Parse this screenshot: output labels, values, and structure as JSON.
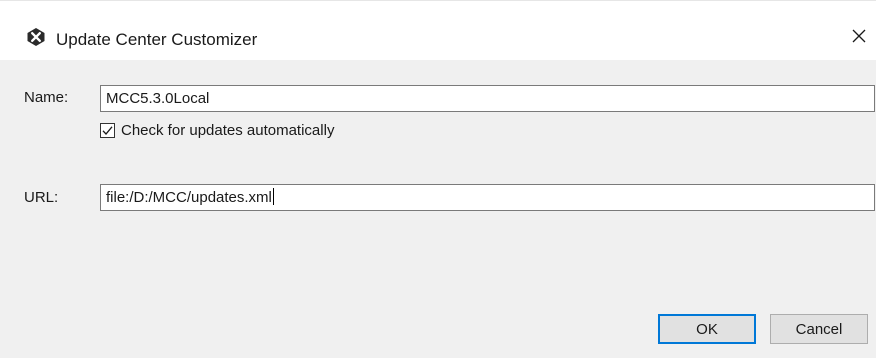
{
  "window": {
    "title": "Update Center Customizer",
    "app_icon": "x-app-icon",
    "close_icon": "close-icon"
  },
  "form": {
    "name_label": "Name:",
    "name_value": "MCC5.3.0Local",
    "auto_check_label": "Check for updates automatically",
    "auto_check_checked": true,
    "url_label": "URL:",
    "url_value": "file:/D:/MCC/updates.xml"
  },
  "buttons": {
    "ok_label": "OK",
    "cancel_label": "Cancel"
  },
  "colors": {
    "content_bg": "#f0f0f0",
    "default_button_border": "#0078d7",
    "app_icon_bg": "#2b2b2b"
  }
}
